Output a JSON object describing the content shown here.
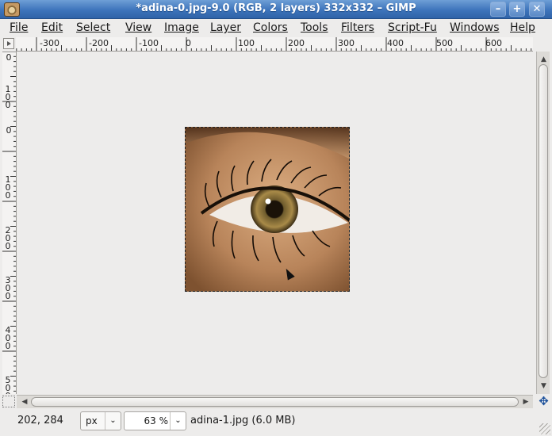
{
  "window": {
    "title": "*adina-0.jpg-9.0 (RGB, 2 layers) 332x332 – GIMP",
    "minimize": "–",
    "maximize": "+",
    "close": "✕"
  },
  "menu": [
    {
      "label": "File"
    },
    {
      "label": "Edit"
    },
    {
      "label": "Select"
    },
    {
      "label": "View"
    },
    {
      "label": "Image"
    },
    {
      "label": "Layer"
    },
    {
      "label": "Colors"
    },
    {
      "label": "Tools"
    },
    {
      "label": "Filters"
    },
    {
      "label": "Script-Fu"
    },
    {
      "label": "Windows"
    },
    {
      "label": "Help"
    }
  ],
  "hruler": {
    "labels": [
      "-300",
      "-200",
      "-100",
      "0",
      "100",
      "200",
      "300",
      "400",
      "500",
      "600"
    ]
  },
  "vruler": {
    "labels": [
      "0",
      "100",
      "0",
      "100",
      "200",
      "300",
      "400",
      "500"
    ]
  },
  "status": {
    "coords": "202, 284",
    "unit": "px",
    "zoom": "63 %",
    "file_info": "adina-1.jpg (6.0 MB)"
  },
  "icons": {
    "app": "gimp-eye-icon",
    "cursor": "mouse-pointer-icon",
    "navigate": "navigate-icon"
  },
  "colors": {
    "titlebar": "#3d74bb",
    "canvas_bg": "#edeceb"
  }
}
